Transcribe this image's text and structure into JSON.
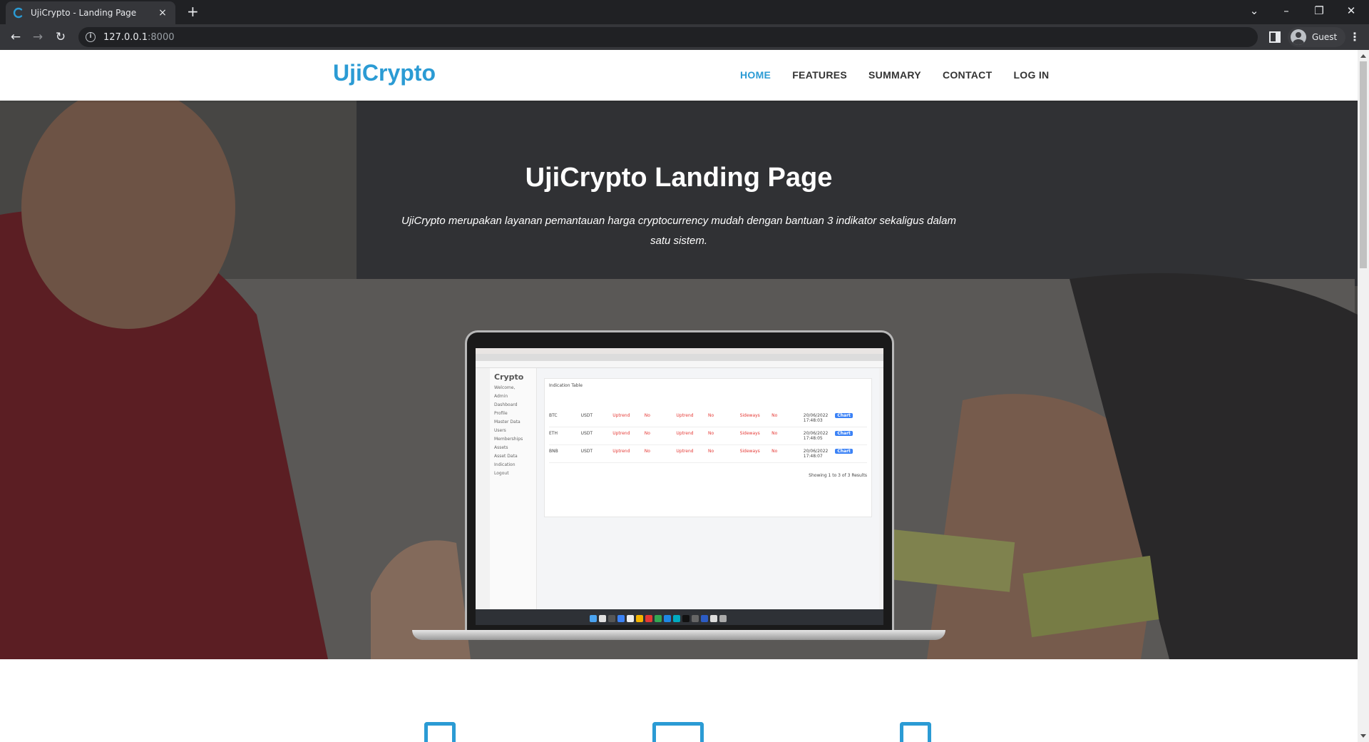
{
  "browser": {
    "tab_title": "UjiCrypto - Landing Page",
    "tab_close": "×",
    "new_tab": "+",
    "url_host": "127.0.0.1",
    "url_port": ":8000",
    "profile_name": "Guest",
    "icons": {
      "back": "←",
      "forward": "→",
      "reload": "↻",
      "minimize": "–",
      "restore": "❐",
      "close": "✕",
      "tab_search": "⌄",
      "menu": "⋮"
    }
  },
  "site": {
    "brand": "UjiCrypto",
    "brand_color": "#2b9bd4",
    "nav": [
      {
        "label": "HOME",
        "active": true
      },
      {
        "label": "FEATURES"
      },
      {
        "label": "SUMMARY"
      },
      {
        "label": "CONTACT"
      },
      {
        "label": "LOG IN"
      }
    ]
  },
  "hero": {
    "title": "UjiCrypto Landing Page",
    "subtitle": "UjiCrypto merupakan layanan pemantauan harga cryptocurrency mudah dengan bantuan 3 indikator sekaligus dalam satu sistem."
  },
  "mockup": {
    "logo": "Crypto",
    "sidebar": [
      "Welcome,",
      "Admin",
      "Dashboard",
      "Profile",
      "Master Data",
      "Users",
      "Memberships",
      "Assets",
      "Asset Data",
      "Indication",
      "Logout"
    ],
    "table_title": "Indication Table",
    "rows": [
      {
        "base": "BTC",
        "quote": "USDT",
        "trend": "Uptrend",
        "cross": "No",
        "peak": "Uptrend",
        "rev": "No",
        "stoch": "Sideways",
        "sc": "No",
        "updated": "20/06/2022 17:48:03",
        "action": "Chart"
      },
      {
        "base": "ETH",
        "quote": "USDT",
        "trend": "Uptrend",
        "cross": "No",
        "peak": "Uptrend",
        "rev": "No",
        "stoch": "Sideways",
        "sc": "No",
        "updated": "20/06/2022 17:48:05",
        "action": "Chart"
      },
      {
        "base": "BNB",
        "quote": "USDT",
        "trend": "Uptrend",
        "cross": "No",
        "peak": "Uptrend",
        "rev": "No",
        "stoch": "Sideways",
        "sc": "No",
        "updated": "20/06/2022 17:48:07",
        "action": "Chart"
      }
    ],
    "footer": "Showing 1 to 3 of 3 Results"
  }
}
